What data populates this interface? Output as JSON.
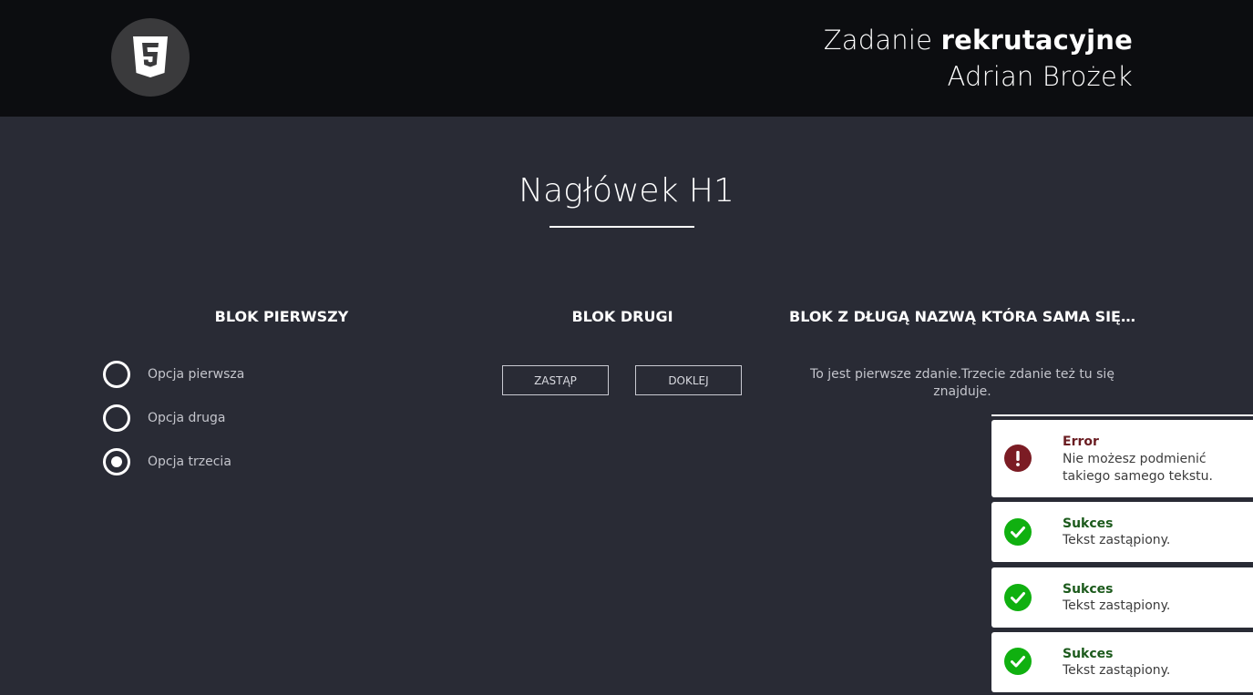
{
  "header": {
    "title_regular": "Zadanie",
    "title_bold": "rekrutacyjne",
    "author": "Adrian Brożek",
    "logo_icon": "html5-icon"
  },
  "main": {
    "h1": "Nagłówek H1"
  },
  "block1": {
    "title": "BLOK PIERWSZY",
    "options": [
      {
        "label": "Opcja pierwsza",
        "selected": false
      },
      {
        "label": "Opcja druga",
        "selected": false
      },
      {
        "label": "Opcja trzecia",
        "selected": true
      }
    ]
  },
  "block2": {
    "title": "BLOK DRUGI",
    "replace_label": "ZASTĄP",
    "append_label": "DOKLEJ"
  },
  "block3": {
    "title": "BLOK Z DŁUGĄ NAZWĄ KTÓRA SAMA SIĘ PR...",
    "text": "To jest pierwsze zdanie.Trzecie zdanie też tu się znajduje."
  },
  "toasts": [
    {
      "type": "error",
      "title": "Error",
      "message": "Nie możesz podmienić takiego samego tekstu.",
      "icon": "exclamation-icon"
    },
    {
      "type": "success",
      "title": "Sukces",
      "message": "Tekst zastąpiony.",
      "icon": "checkmark-icon"
    },
    {
      "type": "success",
      "title": "Sukces",
      "message": "Tekst zastąpiony.",
      "icon": "checkmark-icon"
    },
    {
      "type": "success",
      "title": "Sukces",
      "message": "Tekst zastąpiony.",
      "icon": "checkmark-icon"
    }
  ],
  "colors": {
    "background": "#292b35",
    "header": "#0c0d10",
    "error": "#7b1c24",
    "success": "#10b010"
  }
}
